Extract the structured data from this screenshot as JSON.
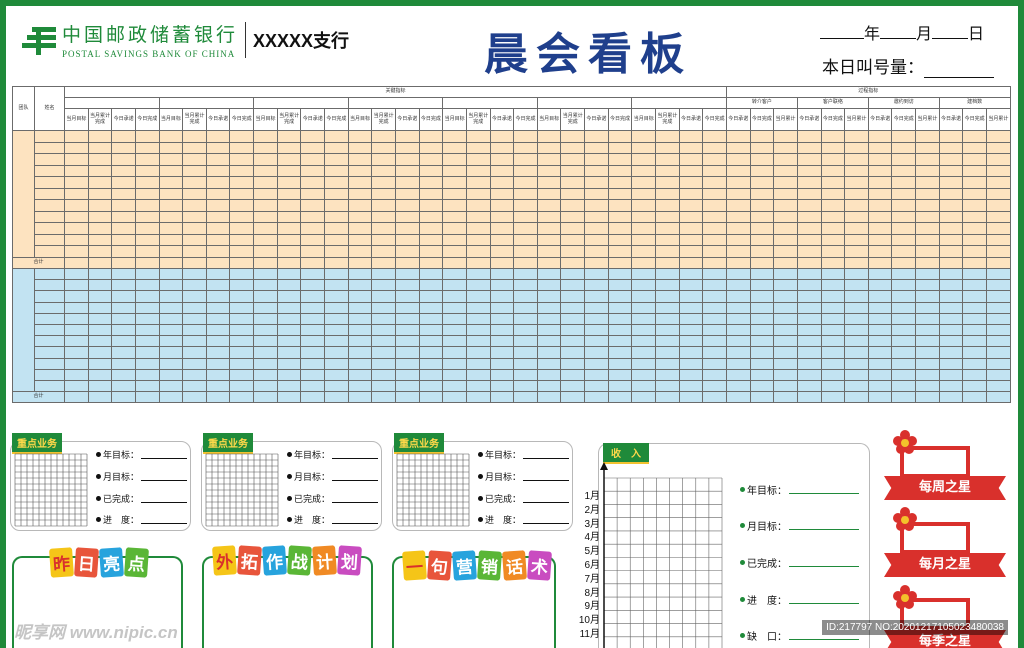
{
  "header": {
    "bank_cn": "中国邮政储蓄银行",
    "bank_en": "POSTAL SAVINGS BANK OF CHINA",
    "branch": "XXXXX支行",
    "title": "晨会看板",
    "year": "年",
    "month": "月",
    "day": "日",
    "queue_label": "本日叫号量："
  },
  "table": {
    "col_team": "团队",
    "col_name": "姓名",
    "group_key": "关键指标",
    "group_process": "过程指标",
    "process_subgroups": [
      "转介客户",
      "客户联络",
      "邀约到访",
      "建档数"
    ],
    "key_sub_cols": [
      "当月目标",
      "当月累计完成",
      "今日承诺",
      "今日完成"
    ],
    "process_sub_cols": [
      "今日承诺",
      "今日完成",
      "当月累计"
    ],
    "total_label": "合计"
  },
  "colors": {
    "brand_green": "#1f8a3a",
    "title_blue": "#1f3f8c",
    "row_orange": "#fde3c0",
    "row_blue": "#c2e3f2",
    "ribbon_red": "#d9302c"
  },
  "cards": [
    {
      "tag": "重点业务",
      "year_goal": "年目标：",
      "month_goal": "月目标：",
      "done": "已完成：",
      "progress": "进　度："
    },
    {
      "tag": "重点业务",
      "year_goal": "年目标：",
      "month_goal": "月目标：",
      "done": "已完成：",
      "progress": "进　度："
    },
    {
      "tag": "重点业务",
      "year_goal": "年目标：",
      "month_goal": "月目标：",
      "done": "已完成：",
      "progress": "进　度："
    }
  ],
  "blocks": {
    "yesterday": [
      "昨",
      "日",
      "亮",
      "点"
    ],
    "expand": [
      "外",
      "拓",
      "作",
      "战",
      "计",
      "划"
    ],
    "marketing": [
      "一",
      "句",
      "营",
      "销",
      "话",
      "术"
    ]
  },
  "income": {
    "tag": "收　入",
    "months": [
      "1月",
      "2月",
      "3月",
      "4月",
      "5月",
      "6月",
      "7月",
      "8月",
      "9月",
      "10月",
      "11月"
    ],
    "year_goal": "年目标：",
    "month_goal": "月目标：",
    "done": "已完成：",
    "progress": "进　度：",
    "gap": "缺　口："
  },
  "stars": [
    "每周之星",
    "每月之星",
    "每季之星"
  ],
  "watermark": {
    "left": "昵享网 www.nipic.cn",
    "right": "ID:217797 NO:20201217105023480038"
  }
}
